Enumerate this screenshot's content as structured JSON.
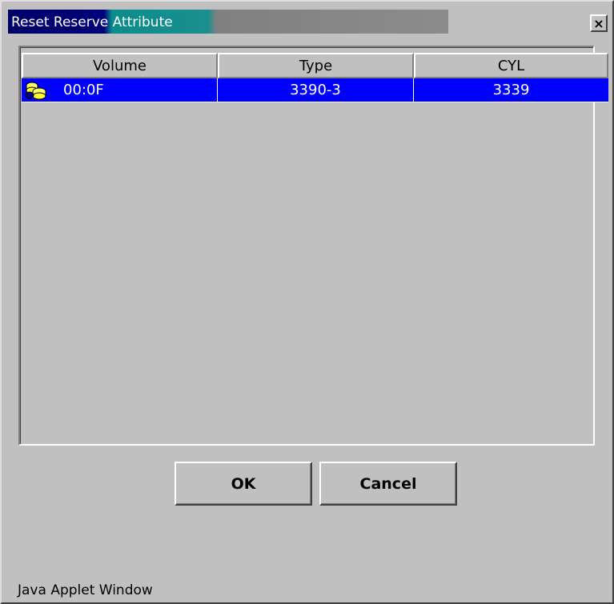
{
  "window": {
    "title": "Reset Reserve Attribute",
    "close_label": "×"
  },
  "table": {
    "columns": [
      "Volume",
      "Type",
      "CYL"
    ],
    "rows": [
      {
        "icon": "volume-icon",
        "volume": "00:0F",
        "type": "3390-3",
        "cyl": "3339",
        "selected": true
      }
    ]
  },
  "buttons": {
    "ok": "OK",
    "cancel": "Cancel"
  },
  "footer": {
    "text": "Java Applet Window"
  },
  "colors": {
    "title_start": "#00006a",
    "title_mid": "#0c8c8c",
    "title_end": "#8c8c8c",
    "selection": "#0000ff",
    "window_bg": "#c0c0c0"
  }
}
